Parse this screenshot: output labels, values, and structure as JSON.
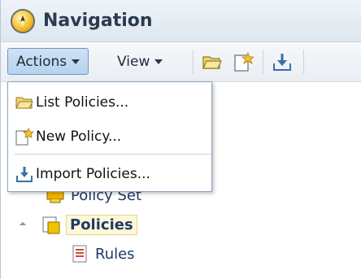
{
  "header": {
    "title": "Navigation",
    "icon": "navigation-compass-icon"
  },
  "toolbar": {
    "actions_label": "Actions",
    "view_label": "View",
    "icons": [
      "open-folder-icon",
      "new-document-star-icon",
      "import-download-icon"
    ]
  },
  "actions_menu": {
    "items": [
      {
        "label": "List Policies...",
        "icon": "open-folder-icon"
      },
      {
        "label": "New Policy...",
        "icon": "new-document-star-icon"
      },
      {
        "label": "Import Policies...",
        "icon": "import-download-icon"
      }
    ]
  },
  "tree": {
    "items": [
      {
        "label": "Policy Set",
        "icon": "policy-set-icon"
      },
      {
        "label": "Policies",
        "icon": "policies-icon",
        "selected": true
      },
      {
        "label": "Rules",
        "icon": "rules-icon"
      }
    ]
  },
  "colors": {
    "header_title": "#2b3b4f",
    "tree_text": "#1f3a66",
    "active_menu_bg": "#b7d2ee"
  }
}
